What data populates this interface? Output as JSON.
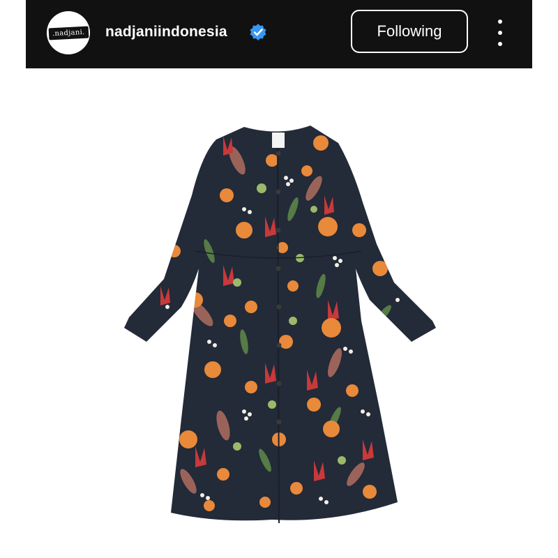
{
  "header": {
    "avatar_text": ".nadjani.",
    "username": "nadjaniindonesia",
    "verified_icon": "verified-badge-icon",
    "follow_label": "Following",
    "more_icon": "more-vertical-icon"
  },
  "post": {
    "image_icon": "dress-product-photo"
  },
  "colors": {
    "header_bg": "#111111",
    "verified": "#3897f0",
    "dress_base": "#232a38",
    "flower_orange": "#e9893a",
    "flower_red": "#c8393a"
  }
}
